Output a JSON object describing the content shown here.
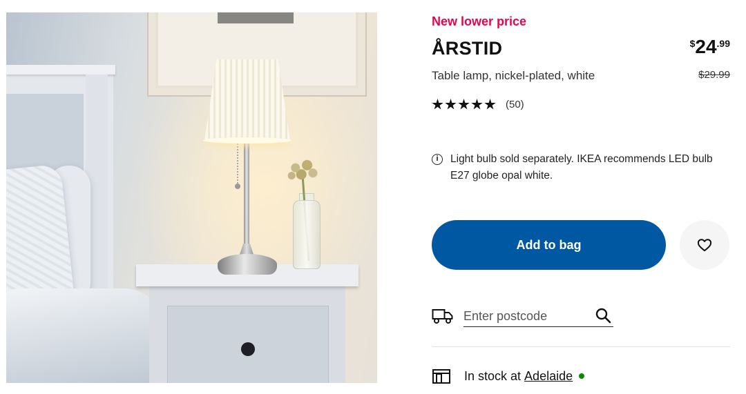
{
  "product": {
    "badge": "New lower price",
    "name": "ÅRSTID",
    "description": "Table lamp, nickel-plated, white",
    "price": {
      "currency": "$",
      "integer": "24",
      "decimal": ".99"
    },
    "old_price": "$29.99",
    "rating": {
      "stars": 5,
      "review_count": "(50)"
    },
    "info": "Light bulb sold separately. IKEA recommends LED bulb E27 globe opal white.",
    "image_alt": "ÅRSTID table lamp on a white bedside table"
  },
  "actions": {
    "add_to_bag_label": "Add to bag",
    "favourite_icon": "heart-icon"
  },
  "delivery": {
    "icon": "truck-icon",
    "postcode_placeholder": "Enter postcode",
    "search_icon": "search-icon"
  },
  "stock": {
    "icon": "store-icon",
    "text": "In stock at",
    "store": "Adelaide",
    "status_color": "#0a8a00"
  },
  "colors": {
    "accent_blue": "#0058a3",
    "badge_red": "#e00751"
  }
}
